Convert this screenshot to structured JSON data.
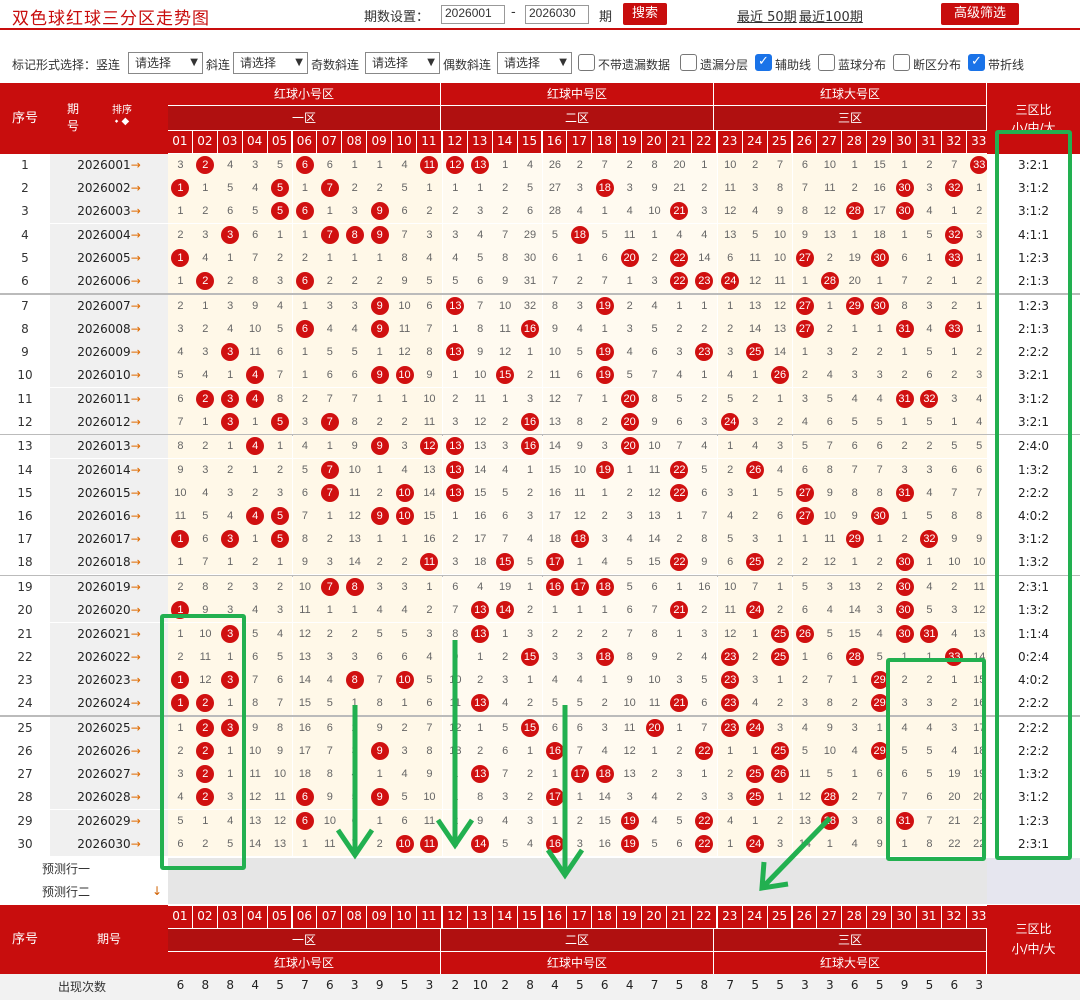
{
  "app": {
    "title": "双色球红球三分区走势图",
    "period_label": "期数设置：",
    "from": "2026001",
    "to": "2026030",
    "qi": "期",
    "search": "搜索",
    "last50": "最近 50期",
    "last100": "最近100期",
    "advanced": "高级筛选"
  },
  "filters": {
    "mark_label": "标记形式选择：竖连",
    "select_placeholder": "请选择",
    "xielian": "斜连",
    "odd": "奇数斜连",
    "even": "偶数斜连",
    "cb_no_miss": "不带遗漏数据",
    "cb_layer": "遗漏分层",
    "cb_aux": "辅助线",
    "cb_blue": "蓝球分布",
    "cb_break": "断区分布",
    "cb_fold": "带折线"
  },
  "header": {
    "seq": "序号",
    "period": "期号",
    "sort": "排序",
    "zone_small": "红球小号区",
    "zone_mid": "红球中号区",
    "zone_big": "红球大号区",
    "z1": "一区",
    "z2": "二区",
    "z3": "三区",
    "ratio_title": "三区比",
    "ratio_sub": "小/中/大"
  },
  "numbers": [
    "01",
    "02",
    "03",
    "04",
    "05",
    "06",
    "07",
    "08",
    "09",
    "10",
    "11",
    "12",
    "13",
    "14",
    "15",
    "16",
    "17",
    "18",
    "19",
    "20",
    "21",
    "22",
    "23",
    "24",
    "25",
    "26",
    "27",
    "28",
    "29",
    "30",
    "31",
    "32",
    "33"
  ],
  "rows": [
    {
      "n": "1",
      "p": "2026001",
      "r": "3:2:1",
      "c": [
        "3",
        "2*",
        "4",
        "3",
        "5",
        "6*",
        "6",
        "1",
        "1",
        "4",
        "11*",
        "12*",
        "13*",
        "1",
        "4",
        "26",
        "2",
        "7",
        "2",
        "8",
        "20",
        "1",
        "10",
        "2",
        "7",
        "6",
        "10",
        "1",
        "15",
        "1",
        "2",
        "7",
        "33*"
      ]
    },
    {
      "n": "2",
      "p": "2026002",
      "r": "3:1:2",
      "c": [
        "1*",
        "1",
        "5",
        "4",
        "5*",
        "1",
        "7*",
        "2",
        "2",
        "5",
        "1",
        "1",
        "1",
        "2",
        "5",
        "27",
        "3",
        "18*",
        "3",
        "9",
        "21",
        "2",
        "11",
        "3",
        "8",
        "7",
        "11",
        "2",
        "16",
        "30*",
        "3",
        "32*",
        "1"
      ]
    },
    {
      "n": "3",
      "p": "2026003",
      "r": "3:1:2",
      "c": [
        "1",
        "2",
        "6",
        "5",
        "5*",
        "6*",
        "1",
        "3",
        "9*",
        "6",
        "2",
        "2",
        "3",
        "2",
        "6",
        "28",
        "4",
        "1",
        "4",
        "10",
        "21*",
        "3",
        "12",
        "4",
        "9",
        "8",
        "12",
        "28*",
        "17",
        "30*",
        "4",
        "1",
        "2"
      ]
    },
    {
      "n": "4",
      "p": "2026004",
      "r": "4:1:1",
      "c": [
        "2",
        "3",
        "3*",
        "6",
        "1",
        "1",
        "7*",
        "8*",
        "9*",
        "7",
        "3",
        "3",
        "4",
        "7",
        "29",
        "5",
        "18*",
        "5",
        "11",
        "1",
        "4",
        "4",
        "13",
        "5",
        "10",
        "9",
        "13",
        "1",
        "18",
        "1",
        "5",
        "32*",
        "3"
      ]
    },
    {
      "n": "5",
      "p": "2026005",
      "r": "1:2:3",
      "c": [
        "1*",
        "4",
        "1",
        "7",
        "2",
        "2",
        "1",
        "1",
        "1",
        "8",
        "4",
        "4",
        "5",
        "8",
        "30",
        "6",
        "1",
        "6",
        "20*",
        "2",
        "22*",
        "14",
        "6",
        "11",
        "10",
        "27*",
        "2",
        "19",
        "30*",
        "6",
        "1",
        "33*",
        "1"
      ]
    },
    {
      "n": "6",
      "p": "2026006",
      "r": "2:1:3",
      "c": [
        "1",
        "2*",
        "2",
        "8",
        "3",
        "6*",
        "2",
        "2",
        "2",
        "9",
        "5",
        "5",
        "6",
        "9",
        "31",
        "7",
        "2",
        "7",
        "1",
        "3",
        "22*",
        "23*",
        "24*",
        "12",
        "11",
        "1",
        "28*",
        "20",
        "1",
        "7",
        "2",
        "1",
        "2"
      ]
    },
    {
      "n": "7",
      "p": "2026007",
      "r": "1:2:3",
      "c": [
        "2",
        "1",
        "3",
        "9",
        "4",
        "1",
        "3",
        "3",
        "9*",
        "10",
        "6",
        "13*",
        "7",
        "10",
        "32",
        "8",
        "3",
        "19*",
        "2",
        "4",
        "1",
        "1",
        "1",
        "13",
        "12",
        "27*",
        "1",
        "29*",
        "30*",
        "8",
        "3",
        "2",
        "1"
      ]
    },
    {
      "n": "8",
      "p": "2026008",
      "r": "2:1:3",
      "c": [
        "3",
        "2",
        "4",
        "10",
        "5",
        "6*",
        "4",
        "4",
        "9*",
        "11",
        "7",
        "1",
        "8",
        "11",
        "16*",
        "9",
        "4",
        "1",
        "3",
        "5",
        "2",
        "2",
        "2",
        "14",
        "13",
        "27*",
        "2",
        "1",
        "1",
        "31*",
        "4",
        "33*",
        "1"
      ]
    },
    {
      "n": "9",
      "p": "2026009",
      "r": "2:2:2",
      "c": [
        "4",
        "3",
        "3*",
        "11",
        "6",
        "1",
        "5",
        "5",
        "1",
        "12",
        "8",
        "13*",
        "9",
        "12",
        "1",
        "10",
        "5",
        "19*",
        "4",
        "6",
        "3",
        "23*",
        "3",
        "25*",
        "14",
        "1",
        "3",
        "2",
        "2",
        "1",
        "5",
        "1",
        "2"
      ]
    },
    {
      "n": "10",
      "p": "2026010",
      "r": "3:2:1",
      "c": [
        "5",
        "4",
        "1",
        "4*",
        "7",
        "1",
        "6",
        "6",
        "9*",
        "10*",
        "9",
        "1",
        "10",
        "15*",
        "2",
        "11",
        "6",
        "19*",
        "5",
        "7",
        "4",
        "1",
        "4",
        "1",
        "26*",
        "2",
        "4",
        "3",
        "3",
        "2",
        "6",
        "2",
        "3"
      ]
    },
    {
      "n": "11",
      "p": "2026011",
      "r": "3:1:2",
      "c": [
        "6",
        "2*",
        "3*",
        "4*",
        "8",
        "2",
        "7",
        "7",
        "1",
        "1",
        "10",
        "2",
        "11",
        "1",
        "3",
        "12",
        "7",
        "1",
        "20*",
        "8",
        "5",
        "2",
        "5",
        "2",
        "1",
        "3",
        "5",
        "4",
        "4",
        "31*",
        "32*",
        "3",
        "4"
      ]
    },
    {
      "n": "12",
      "p": "2026012",
      "r": "3:2:1",
      "c": [
        "7",
        "1",
        "3*",
        "1",
        "5*",
        "3",
        "7*",
        "8",
        "2",
        "2",
        "11",
        "3",
        "12",
        "2",
        "16*",
        "13",
        "8",
        "2",
        "20*",
        "9",
        "6",
        "3",
        "24*",
        "3",
        "2",
        "4",
        "6",
        "5",
        "5",
        "1",
        "5",
        "1",
        "4"
      ]
    },
    {
      "n": "13",
      "p": "2026013",
      "r": "2:4:0",
      "c": [
        "8",
        "2",
        "1",
        "4*",
        "1",
        "4",
        "1",
        "9",
        "9*",
        "3",
        "12*",
        "13*",
        "13",
        "3",
        "16*",
        "14",
        "9",
        "3",
        "20*",
        "10",
        "7",
        "4",
        "1",
        "4",
        "3",
        "5",
        "7",
        "6",
        "6",
        "2",
        "2",
        "5",
        "5"
      ]
    },
    {
      "n": "14",
      "p": "2026014",
      "r": "1:3:2",
      "c": [
        "9",
        "3",
        "2",
        "1",
        "2",
        "5",
        "7*",
        "10",
        "1",
        "4",
        "13",
        "13*",
        "14",
        "4",
        "1",
        "15",
        "10",
        "19*",
        "1",
        "11",
        "22*",
        "5",
        "2",
        "26*",
        "4",
        "6",
        "8",
        "7",
        "7",
        "3",
        "3",
        "6",
        "6"
      ]
    },
    {
      "n": "15",
      "p": "2026015",
      "r": "2:2:2",
      "c": [
        "10",
        "4",
        "3",
        "2",
        "3",
        "6",
        "7*",
        "11",
        "2",
        "10*",
        "14",
        "13*",
        "15",
        "5",
        "2",
        "16",
        "11",
        "1",
        "2",
        "12",
        "22*",
        "6",
        "3",
        "1",
        "5",
        "27*",
        "9",
        "8",
        "8",
        "31*",
        "4",
        "7",
        "7"
      ]
    },
    {
      "n": "16",
      "p": "2026016",
      "r": "4:0:2",
      "c": [
        "11",
        "5",
        "4",
        "4*",
        "5*",
        "7",
        "1",
        "12",
        "9*",
        "10*",
        "15",
        "1",
        "16",
        "6",
        "3",
        "17",
        "12",
        "2",
        "3",
        "13",
        "1",
        "7",
        "4",
        "2",
        "6",
        "27*",
        "10",
        "9",
        "30*",
        "1",
        "5",
        "8",
        "8"
      ]
    },
    {
      "n": "17",
      "p": "2026017",
      "r": "3:1:2",
      "c": [
        "1*",
        "6",
        "3*",
        "1",
        "5*",
        "8",
        "2",
        "13",
        "1",
        "1",
        "16",
        "2",
        "17",
        "7",
        "4",
        "18",
        "18*",
        "3",
        "4",
        "14",
        "2",
        "8",
        "5",
        "3",
        "1",
        "1",
        "11",
        "29*",
        "1",
        "2",
        "32*",
        "9",
        "9"
      ]
    },
    {
      "n": "18",
      "p": "2026018",
      "r": "1:3:2",
      "c": [
        "1",
        "7",
        "1",
        "2",
        "1",
        "9",
        "3",
        "14",
        "2",
        "2",
        "11*",
        "3",
        "18",
        "15*",
        "5",
        "17*",
        "1",
        "4",
        "5",
        "15",
        "22*",
        "9",
        "6",
        "25*",
        "2",
        "2",
        "12",
        "1",
        "2",
        "30*",
        "1",
        "10",
        "10"
      ]
    },
    {
      "n": "19",
      "p": "2026019",
      "r": "2:3:1",
      "c": [
        "2",
        "8",
        "2",
        "3",
        "2",
        "10",
        "7*",
        "8*",
        "3",
        "3",
        "1",
        "6",
        "4",
        "19",
        "1",
        "16*",
        "17*",
        "18*",
        "5",
        "6",
        "1",
        "16",
        "10",
        "7",
        "1",
        "5",
        "3",
        "13",
        "2",
        "30*",
        "4",
        "2",
        "11"
      ]
    },
    {
      "n": "20",
      "p": "2026020",
      "r": "1:3:2",
      "c": [
        "1*",
        "9",
        "3",
        "4",
        "3",
        "11",
        "1",
        "1",
        "4",
        "4",
        "2",
        "7",
        "13*",
        "14*",
        "2",
        "1",
        "1",
        "1",
        "6",
        "7",
        "21*",
        "2",
        "11",
        "24*",
        "2",
        "6",
        "4",
        "14",
        "3",
        "30*",
        "5",
        "3",
        "12"
      ]
    },
    {
      "n": "21",
      "p": "2026021",
      "r": "1:1:4",
      "c": [
        "1",
        "10",
        "3*",
        "5",
        "4",
        "12",
        "2",
        "2",
        "5",
        "5",
        "3",
        "8",
        "13*",
        "1",
        "3",
        "2",
        "2",
        "2",
        "7",
        "8",
        "1",
        "3",
        "12",
        "1",
        "25*",
        "26*",
        "5",
        "15",
        "4",
        "30*",
        "31*",
        "4",
        "13"
      ]
    },
    {
      "n": "22",
      "p": "2026022",
      "r": "0:2:4",
      "c": [
        "2",
        "11",
        "1",
        "6",
        "5",
        "13",
        "3",
        "3",
        "6",
        "6",
        "4",
        "9",
        "1",
        "2",
        "15*",
        "3",
        "3",
        "18*",
        "8",
        "9",
        "2",
        "4",
        "23*",
        "2",
        "25*",
        "1",
        "6",
        "28*",
        "5",
        "1",
        "1",
        "33*",
        "14"
      ]
    },
    {
      "n": "23",
      "p": "2026023",
      "r": "4:0:2",
      "c": [
        "1*",
        "12",
        "3*",
        "7",
        "6",
        "14",
        "4",
        "8*",
        "7",
        "10*",
        "5",
        "10",
        "2",
        "3",
        "1",
        "4",
        "4",
        "1",
        "9",
        "10",
        "3",
        "5",
        "23*",
        "3",
        "1",
        "2",
        "7",
        "1",
        "29*",
        "2",
        "2",
        "1",
        "15"
      ]
    },
    {
      "n": "24",
      "p": "2026024",
      "r": "2:2:2",
      "c": [
        "1*",
        "2*",
        "1",
        "8",
        "7",
        "15",
        "5",
        "1",
        "8",
        "1",
        "6",
        "11",
        "13*",
        "4",
        "2",
        "5",
        "5",
        "2",
        "10",
        "11",
        "21*",
        "6",
        "23*",
        "4",
        "2",
        "3",
        "8",
        "2",
        "29*",
        "3",
        "3",
        "2",
        "16"
      ]
    },
    {
      "n": "25",
      "p": "2026025",
      "r": "2:2:2",
      "c": [
        "1",
        "2*",
        "3*",
        "9",
        "8",
        "16",
        "6",
        "2",
        "9",
        "2",
        "7",
        "12",
        "1",
        "5",
        "15*",
        "6",
        "6",
        "3",
        "11",
        "20*",
        "1",
        "7",
        "23*",
        "24*",
        "3",
        "4",
        "9",
        "3",
        "1",
        "4",
        "4",
        "3",
        "17"
      ]
    },
    {
      "n": "26",
      "p": "2026026",
      "r": "2:2:2",
      "c": [
        "2",
        "2*",
        "1",
        "10",
        "9",
        "17",
        "7",
        "3",
        "9*",
        "3",
        "8",
        "13",
        "2",
        "6",
        "1",
        "16*",
        "7",
        "4",
        "12",
        "1",
        "2",
        "22*",
        "1",
        "1",
        "25*",
        "5",
        "10",
        "4",
        "29*",
        "5",
        "5",
        "4",
        "18"
      ]
    },
    {
      "n": "27",
      "p": "2026027",
      "r": "1:3:2",
      "c": [
        "3",
        "2*",
        "1",
        "11",
        "10",
        "18",
        "8",
        "4",
        "1",
        "4",
        "9",
        "1",
        "13*",
        "7",
        "2",
        "1",
        "17*",
        "18*",
        "13",
        "2",
        "3",
        "1",
        "2",
        "25*",
        "26*",
        "11",
        "5",
        "1",
        "6",
        "6",
        "5",
        "19",
        "19"
      ]
    },
    {
      "n": "28",
      "p": "2026028",
      "r": "3:1:2",
      "c": [
        "4",
        "2*",
        "3",
        "12",
        "11",
        "6*",
        "9",
        "5",
        "9*",
        "5",
        "10",
        "1",
        "8",
        "3",
        "2",
        "17*",
        "1",
        "14",
        "3",
        "4",
        "2",
        "3",
        "3",
        "25*",
        "1",
        "12",
        "28*",
        "2",
        "7",
        "7",
        "6",
        "20",
        "20"
      ]
    },
    {
      "n": "29",
      "p": "2026029",
      "r": "1:2:3",
      "c": [
        "5",
        "1",
        "4",
        "13",
        "12",
        "6*",
        "10",
        "6",
        "1",
        "6",
        "11",
        "2",
        "9",
        "4",
        "3",
        "1",
        "2",
        "15",
        "19*",
        "4",
        "5",
        "22*",
        "4",
        "1",
        "2",
        "13",
        "28*",
        "3",
        "8",
        "31*",
        "7",
        "21",
        "21"
      ]
    },
    {
      "n": "30",
      "p": "2026030",
      "r": "2:3:1",
      "c": [
        "6",
        "2",
        "5",
        "14",
        "13",
        "1",
        "11",
        "7",
        "2",
        "10*",
        "11*",
        "3",
        "14*",
        "5",
        "4",
        "16*",
        "3",
        "16",
        "19*",
        "5",
        "6",
        "22*",
        "1",
        "24*",
        "3",
        "14",
        "1",
        "4",
        "9",
        "1",
        "8",
        "22",
        "22"
      ]
    }
  ],
  "predict": {
    "p1": "预测行一",
    "p2": "预测行二"
  },
  "bottom": {
    "seq": "序号",
    "period": "期号",
    "count_label": "出现次数",
    "counts": [
      "6",
      "8",
      "8",
      "4",
      "5",
      "7",
      "6",
      "3",
      "9",
      "5",
      "3",
      "2",
      "10",
      "2",
      "8",
      "4",
      "5",
      "6",
      "4",
      "7",
      "5",
      "8",
      "7",
      "5",
      "5",
      "3",
      "3",
      "6",
      "5",
      "9",
      "5",
      "6",
      "3"
    ]
  }
}
